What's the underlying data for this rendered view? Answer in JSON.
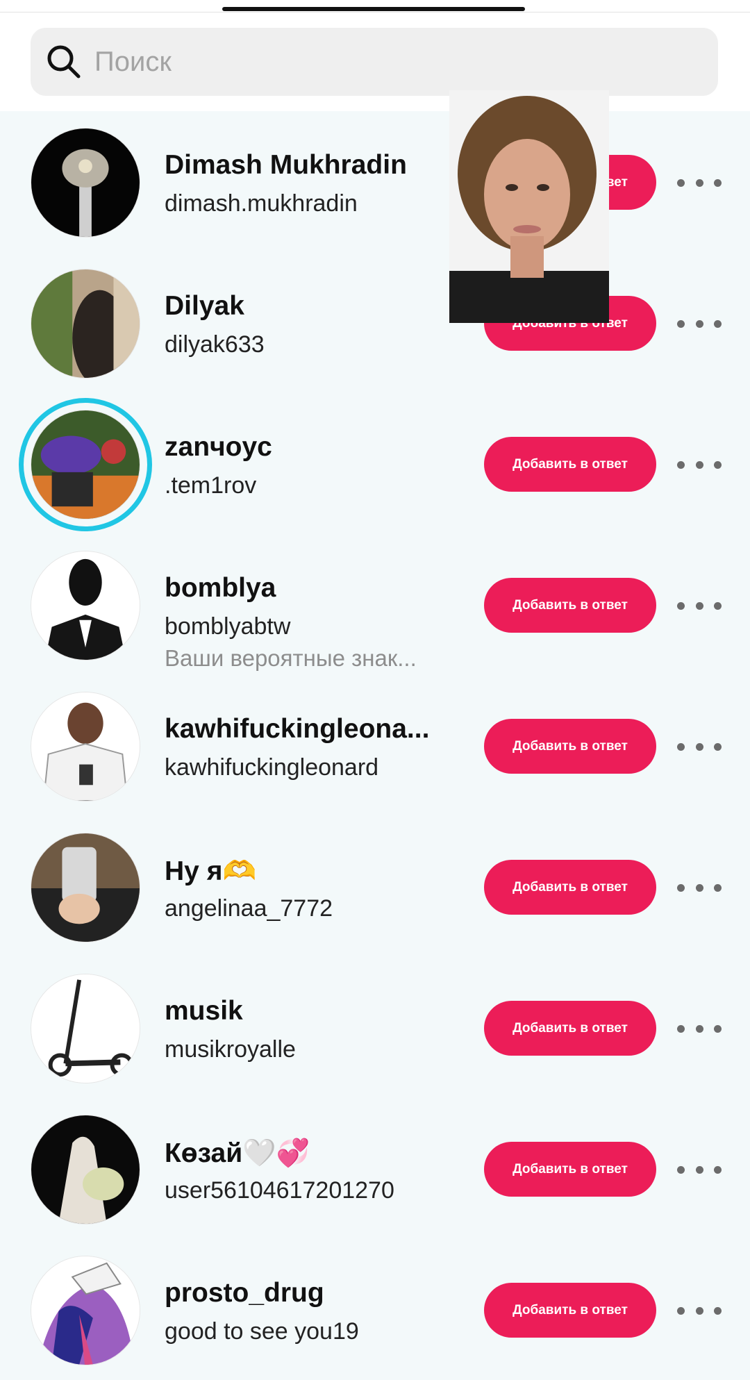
{
  "search": {
    "placeholder": "Поиск",
    "value": ""
  },
  "add_button_label": "Добавить в ответ",
  "colors": {
    "accent": "#ec1d58",
    "story_ring": "#20c6e4",
    "background": "#f3f9fa"
  },
  "users": [
    {
      "name": "Dimash Mukhradin",
      "handle": "dimash.mukhradin",
      "subtitle": ""
    },
    {
      "name": "Dilyak",
      "handle": "dilyak633",
      "subtitle": ""
    },
    {
      "name": "zanчoyc",
      "handle": ".tem1rov",
      "subtitle": ""
    },
    {
      "name": "bomblya",
      "handle": "bomblyabtw",
      "subtitle": "Ваши вероятные знак..."
    },
    {
      "name": "kawhifuckingleona...",
      "handle": "kawhifuckingleonard",
      "subtitle": ""
    },
    {
      "name": "Ну я🫶",
      "handle": "angelinaa_7772",
      "subtitle": ""
    },
    {
      "name": "musik",
      "handle": "musikroyalle",
      "subtitle": ""
    },
    {
      "name": "Көзай🤍💞",
      "handle": "user56104617201270",
      "subtitle": ""
    },
    {
      "name": "prosto_drug",
      "handle": "good to see you19",
      "subtitle": ""
    }
  ]
}
